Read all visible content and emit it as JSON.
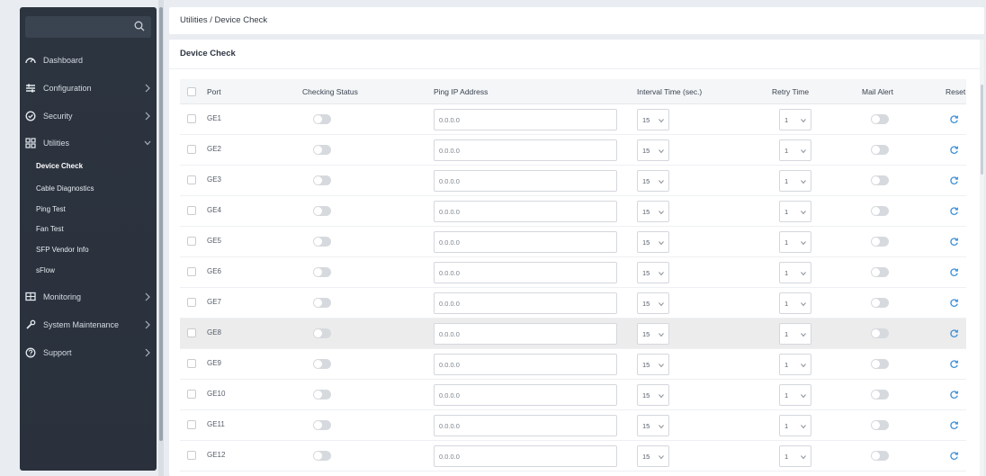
{
  "sidebar": {
    "search": {
      "placeholder": "Search"
    },
    "items": [
      {
        "label": "Dashboard",
        "icon": "dashboard-icon",
        "expandable": false
      },
      {
        "label": "Configuration",
        "icon": "sliders-icon",
        "expandable": true
      },
      {
        "label": "Security",
        "icon": "shield-icon",
        "expandable": true
      },
      {
        "label": "Utilities",
        "icon": "grid-icon",
        "expandable": true,
        "expanded": true
      },
      {
        "label": "Monitoring",
        "icon": "monitor-icon",
        "expandable": true
      },
      {
        "label": "System Maintenance",
        "icon": "wrench-icon",
        "expandable": true
      },
      {
        "label": "Support",
        "icon": "help-icon",
        "expandable": true
      }
    ],
    "utilities_sub": [
      {
        "label": "Device Check",
        "active": true
      },
      {
        "label": "Cable Diagnostics",
        "active": false
      },
      {
        "label": "Ping Test",
        "active": false
      },
      {
        "label": "Fan Test",
        "active": false
      },
      {
        "label": "SFP Vendor Info",
        "active": false
      },
      {
        "label": "sFlow",
        "active": false
      }
    ]
  },
  "breadcrumb": "Utilities / Device Check",
  "panel": {
    "title": "Device Check"
  },
  "table": {
    "headers": {
      "port": "Port",
      "checking_status": "Checking Status",
      "ping_ip": "Ping IP Address",
      "interval": "Interval Time (sec.)",
      "retry": "Retry Time",
      "mail_alert": "Mail Alert",
      "reset": "Reset"
    },
    "rows": [
      {
        "port": "GE1",
        "ip": "0.0.0.0",
        "interval": "15",
        "retry": "1"
      },
      {
        "port": "GE2",
        "ip": "0.0.0.0",
        "interval": "15",
        "retry": "1"
      },
      {
        "port": "GE3",
        "ip": "0.0.0.0",
        "interval": "15",
        "retry": "1"
      },
      {
        "port": "GE4",
        "ip": "0.0.0.0",
        "interval": "15",
        "retry": "1"
      },
      {
        "port": "GE5",
        "ip": "0.0.0.0",
        "interval": "15",
        "retry": "1"
      },
      {
        "port": "GE6",
        "ip": "0.0.0.0",
        "interval": "15",
        "retry": "1"
      },
      {
        "port": "GE7",
        "ip": "0.0.0.0",
        "interval": "15",
        "retry": "1"
      },
      {
        "port": "GE8",
        "ip": "0.0.0.0",
        "interval": "15",
        "retry": "1"
      },
      {
        "port": "GE9",
        "ip": "0.0.0.0",
        "interval": "15",
        "retry": "1"
      },
      {
        "port": "GE10",
        "ip": "0.0.0.0",
        "interval": "15",
        "retry": "1"
      },
      {
        "port": "GE11",
        "ip": "0.0.0.0",
        "interval": "15",
        "retry": "1"
      },
      {
        "port": "GE12",
        "ip": "0.0.0.0",
        "interval": "15",
        "retry": "1"
      }
    ]
  },
  "colors": {
    "accent": "#3b8fd9",
    "sidebar_bg": "#2c3440",
    "toggle_off": "#d6dade"
  }
}
